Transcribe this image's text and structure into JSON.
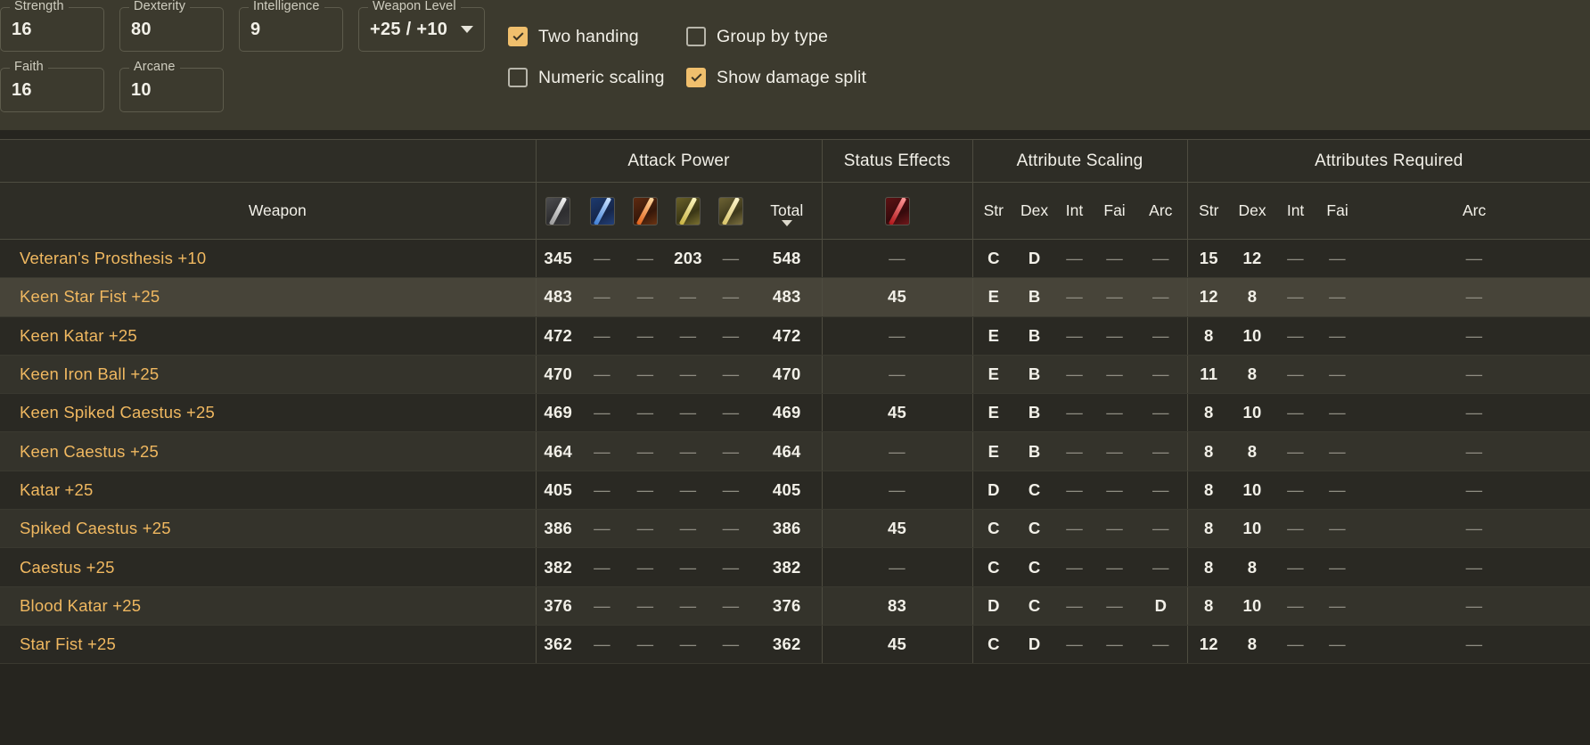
{
  "controls": {
    "stat_fields": [
      {
        "id": "strength",
        "label": "Strength",
        "value": "16"
      },
      {
        "id": "dexterity",
        "label": "Dexterity",
        "value": "80"
      },
      {
        "id": "intelligence",
        "label": "Intelligence",
        "value": "9"
      },
      {
        "id": "weaponlevel",
        "label": "Weapon Level",
        "value": "+25 / +10"
      },
      {
        "id": "faith",
        "label": "Faith",
        "value": "16"
      },
      {
        "id": "arcane",
        "label": "Arcane",
        "value": "10"
      }
    ],
    "toggles": [
      {
        "id": "twohanding",
        "label": "Two handing",
        "checked": true
      },
      {
        "id": "groupbytype",
        "label": "Group by type",
        "checked": false
      },
      {
        "id": "numericscaling",
        "label": "Numeric scaling",
        "checked": false
      },
      {
        "id": "showdamagesplit",
        "label": "Show damage split",
        "checked": true
      }
    ]
  },
  "table": {
    "group_headers": {
      "weapon": "",
      "attack_power": "Attack Power",
      "status_effects": "Status Effects",
      "attribute_scaling": "Attribute Scaling",
      "attributes_required": "Attributes Required"
    },
    "sub_headers": {
      "weapon": "Weapon",
      "attack_icons": [
        "physical-damage-icon",
        "magic-damage-icon",
        "fire-damage-icon",
        "lightning-damage-icon",
        "holy-damage-icon"
      ],
      "total": "Total",
      "status_icons": [
        "bleed-status-icon"
      ],
      "scaling": [
        "Str",
        "Dex",
        "Int",
        "Fai",
        "Arc"
      ],
      "required": [
        "Str",
        "Dex",
        "Int",
        "Fai",
        "Arc"
      ]
    },
    "sort": {
      "column": "Total",
      "direction": "descending",
      "indicator": "caret-down-icon"
    },
    "dash": "—",
    "rows": [
      {
        "name": "Veteran's Prosthesis +10",
        "phys": "345",
        "magic": "—",
        "fire": "—",
        "lightning": "203",
        "holy": "—",
        "total": "548",
        "status": "—",
        "scaling": [
          "C",
          "D",
          "—",
          "—",
          "—"
        ],
        "required": [
          "15",
          "12",
          "—",
          "—",
          "—"
        ],
        "highlighted": false
      },
      {
        "name": "Keen Star Fist +25",
        "phys": "483",
        "magic": "—",
        "fire": "—",
        "lightning": "—",
        "holy": "—",
        "total": "483",
        "status": "45",
        "scaling": [
          "E",
          "B",
          "—",
          "—",
          "—"
        ],
        "required": [
          "12",
          "8",
          "—",
          "—",
          "—"
        ],
        "highlighted": true
      },
      {
        "name": "Keen Katar +25",
        "phys": "472",
        "magic": "—",
        "fire": "—",
        "lightning": "—",
        "holy": "—",
        "total": "472",
        "status": "—",
        "scaling": [
          "E",
          "B",
          "—",
          "—",
          "—"
        ],
        "required": [
          "8",
          "10",
          "—",
          "—",
          "—"
        ],
        "highlighted": false
      },
      {
        "name": "Keen Iron Ball +25",
        "phys": "470",
        "magic": "—",
        "fire": "—",
        "lightning": "—",
        "holy": "—",
        "total": "470",
        "status": "—",
        "scaling": [
          "E",
          "B",
          "—",
          "—",
          "—"
        ],
        "required": [
          "11",
          "8",
          "—",
          "—",
          "—"
        ],
        "highlighted": false
      },
      {
        "name": "Keen Spiked Caestus +25",
        "phys": "469",
        "magic": "—",
        "fire": "—",
        "lightning": "—",
        "holy": "—",
        "total": "469",
        "status": "45",
        "scaling": [
          "E",
          "B",
          "—",
          "—",
          "—"
        ],
        "required": [
          "8",
          "10",
          "—",
          "—",
          "—"
        ],
        "highlighted": false
      },
      {
        "name": "Keen Caestus +25",
        "phys": "464",
        "magic": "—",
        "fire": "—",
        "lightning": "—",
        "holy": "—",
        "total": "464",
        "status": "—",
        "scaling": [
          "E",
          "B",
          "—",
          "—",
          "—"
        ],
        "required": [
          "8",
          "8",
          "—",
          "—",
          "—"
        ],
        "highlighted": false
      },
      {
        "name": "Katar +25",
        "phys": "405",
        "magic": "—",
        "fire": "—",
        "lightning": "—",
        "holy": "—",
        "total": "405",
        "status": "—",
        "scaling": [
          "D",
          "C",
          "—",
          "—",
          "—"
        ],
        "required": [
          "8",
          "10",
          "—",
          "—",
          "—"
        ],
        "highlighted": false
      },
      {
        "name": "Spiked Caestus +25",
        "phys": "386",
        "magic": "—",
        "fire": "—",
        "lightning": "—",
        "holy": "—",
        "total": "386",
        "status": "45",
        "scaling": [
          "C",
          "C",
          "—",
          "—",
          "—"
        ],
        "required": [
          "8",
          "10",
          "—",
          "—",
          "—"
        ],
        "highlighted": false
      },
      {
        "name": "Caestus +25",
        "phys": "382",
        "magic": "—",
        "fire": "—",
        "lightning": "—",
        "holy": "—",
        "total": "382",
        "status": "—",
        "scaling": [
          "C",
          "C",
          "—",
          "—",
          "—"
        ],
        "required": [
          "8",
          "8",
          "—",
          "—",
          "—"
        ],
        "highlighted": false
      },
      {
        "name": "Blood Katar +25",
        "phys": "376",
        "magic": "—",
        "fire": "—",
        "lightning": "—",
        "holy": "—",
        "total": "376",
        "status": "83",
        "scaling": [
          "D",
          "C",
          "—",
          "—",
          "D"
        ],
        "required": [
          "8",
          "10",
          "—",
          "—",
          "—"
        ],
        "highlighted": false
      },
      {
        "name": "Star Fist +25",
        "phys": "362",
        "magic": "—",
        "fire": "—",
        "lightning": "—",
        "holy": "—",
        "total": "362",
        "status": "45",
        "scaling": [
          "C",
          "D",
          "—",
          "—",
          "—"
        ],
        "required": [
          "12",
          "8",
          "—",
          "—",
          "—"
        ],
        "highlighted": false
      }
    ]
  },
  "colors": {
    "bar_background": "#3c3a2e",
    "table_background": "#26251f",
    "weapon_name": "#f0b860",
    "checkbox_on": "#f0bf6d",
    "text": "#f2f0e8",
    "dash": "#8f8d82"
  }
}
